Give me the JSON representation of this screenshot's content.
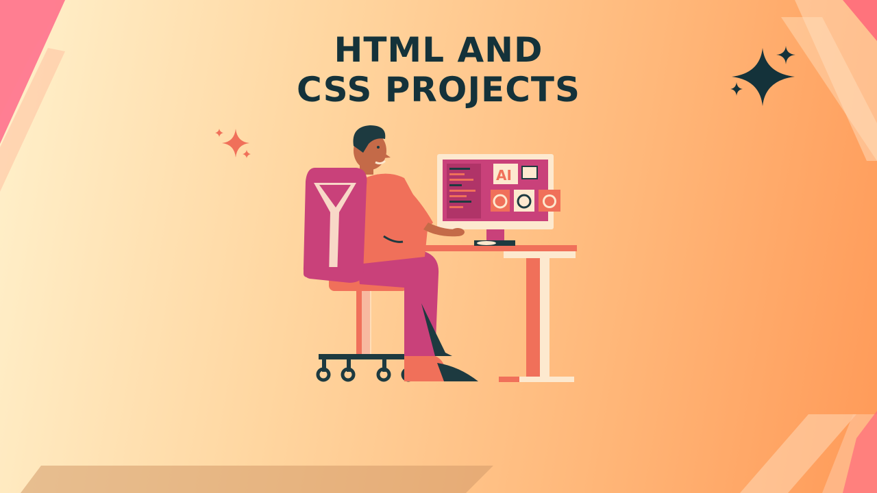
{
  "title": {
    "line1": "HTML AND",
    "line2": "CSS PROJECTS"
  },
  "illustration": {
    "screen_label": "AI",
    "description_icon": "person-at-computer-illustration"
  },
  "colors": {
    "title": "#14323a",
    "accent_pink": "#c9417a",
    "accent_orange": "#f0705a",
    "dark": "#1d3a40",
    "cream": "#fde9cf"
  }
}
